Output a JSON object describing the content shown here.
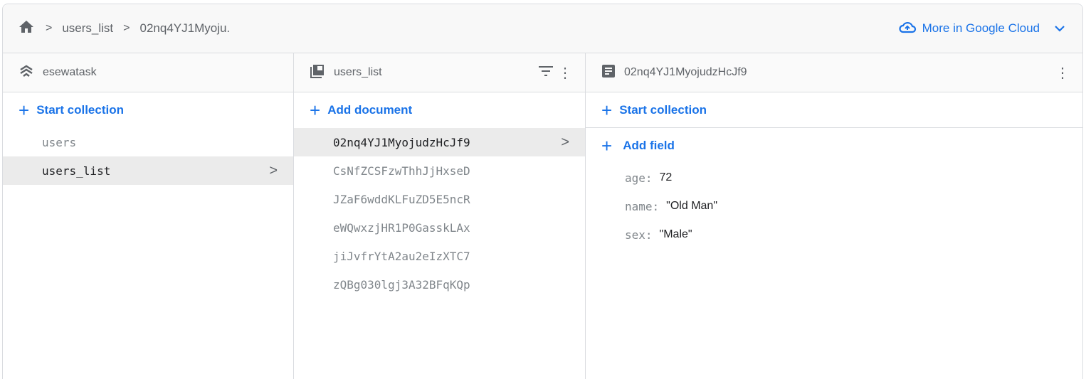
{
  "breadcrumb": {
    "items": [
      "users_list",
      "02nq4YJ1Myoju."
    ]
  },
  "cloud_link": "More in Google Cloud",
  "project": {
    "name": "esewatask",
    "action": "Start collection",
    "collections": [
      "users",
      "users_list"
    ]
  },
  "collection": {
    "name": "users_list",
    "action": "Add document",
    "documents": [
      "02nq4YJ1MyojudzHcJf9",
      "CsNfZCSFzwThhJjHxseD",
      "JZaF6wddKLFuZD5E5ncR",
      "eWQwxzjHR1P0GasskLAx",
      "jiJvfrYtA2au2eIzXTC7",
      "zQBg030lgj3A32BFqKQp"
    ]
  },
  "document": {
    "name": "02nq4YJ1MyojudzHcJf9",
    "action_collection": "Start collection",
    "action_field": "Add field",
    "fields": [
      {
        "key": "age:",
        "value": "72"
      },
      {
        "key": "name:",
        "value": "\"Old Man\""
      },
      {
        "key": "sex:",
        "value": "\"Male\""
      }
    ]
  }
}
